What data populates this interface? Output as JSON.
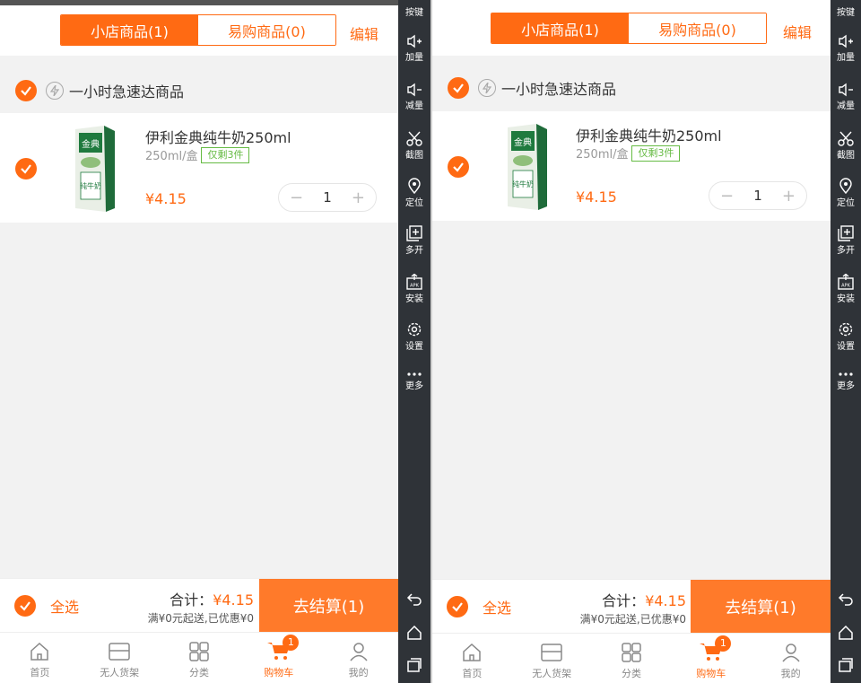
{
  "colors": {
    "accent": "#ff6a13",
    "checkout": "#ff7a2a",
    "sidebar": "#2f3338",
    "badge_green": "#66bb44"
  },
  "header": {
    "tabs": [
      "小店商品(1)",
      "易购商品(0)"
    ],
    "active_tab": 0,
    "edit_label": "编辑"
  },
  "group": {
    "title": "一小时急速达商品",
    "icon": "lightning-icon"
  },
  "item": {
    "name": "伊利金典纯牛奶250ml",
    "spec": "250ml/盒",
    "stock_badge": "仅剩3件",
    "price": "¥4.15",
    "quantity": "1",
    "minus": "−",
    "plus": "+"
  },
  "checkout": {
    "select_all": "全选",
    "total_label": "合计：",
    "total_value": "¥4.15",
    "note": "满¥0元起送,已优惠¥0",
    "button": "去结算(1)"
  },
  "tabbar": {
    "items": [
      {
        "label": "首页",
        "icon": "home-icon"
      },
      {
        "label": "无人货架",
        "icon": "shelf-icon"
      },
      {
        "label": "分类",
        "icon": "grid-icon"
      },
      {
        "label": "购物车",
        "icon": "cart-icon",
        "badge": "1"
      },
      {
        "label": "我的",
        "icon": "user-icon"
      }
    ],
    "active": 3
  },
  "toolbar": {
    "items": [
      {
        "label": "按键",
        "icon": "keypad-icon"
      },
      {
        "label": "加量",
        "icon": "volume-up-icon"
      },
      {
        "label": "减量",
        "icon": "volume-down-icon"
      },
      {
        "label": "截图",
        "icon": "scissors-icon"
      },
      {
        "label": "定位",
        "icon": "location-icon"
      },
      {
        "label": "多开",
        "icon": "multi-window-icon"
      },
      {
        "label": "安装",
        "icon": "apk-install-icon"
      },
      {
        "label": "设置",
        "icon": "settings-icon"
      },
      {
        "label": "更多",
        "icon": "more-icon"
      }
    ],
    "nav": [
      "back-icon",
      "home-icon",
      "recents-icon"
    ]
  }
}
